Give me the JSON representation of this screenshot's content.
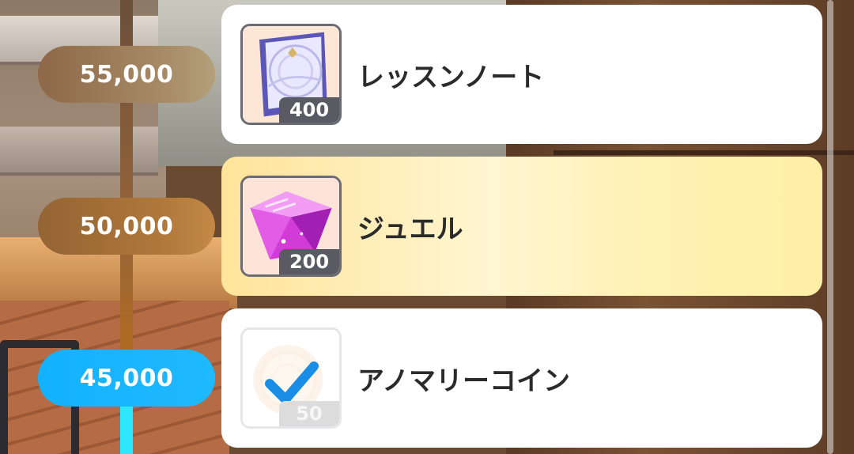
{
  "milestones": [
    {
      "points": "55,000",
      "state": "locked"
    },
    {
      "points": "50,000",
      "state": "current"
    },
    {
      "points": "45,000",
      "state": "claimed"
    }
  ],
  "rewards": [
    {
      "name": "レッスンノート",
      "quantity": "400",
      "icon": "lesson-note-icon",
      "claimed": false,
      "highlighted": false
    },
    {
      "name": "ジュエル",
      "quantity": "200",
      "icon": "jewel-icon",
      "claimed": false,
      "highlighted": true
    },
    {
      "name": "アノマリーコイン",
      "quantity": "50",
      "icon": "anomaly-coin-icon",
      "claimed": true,
      "highlighted": false
    }
  ],
  "colors": {
    "claimed_accent": "#1fb9ff",
    "check": "#1a8ee6",
    "highlight_card": "#fff1b4"
  }
}
